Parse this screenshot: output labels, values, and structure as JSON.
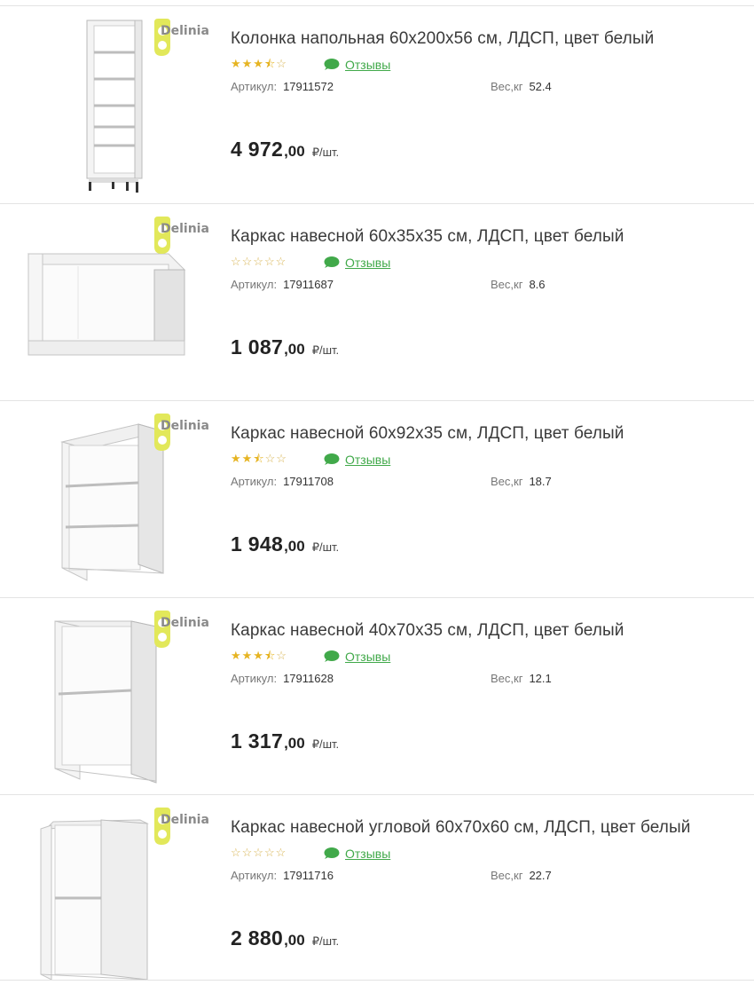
{
  "brand": {
    "logo_text": "Delinia",
    "color": "#e2e85a",
    "text_color": "#8a8a8a"
  },
  "labels": {
    "sku": "Артикул:",
    "weight": "Вес,кг",
    "reviews": "Отзывы",
    "unit": "₽/шт."
  },
  "colors": {
    "star": "#e6b422",
    "link": "#41a94a",
    "separator": "#e3e3e3"
  },
  "products": [
    {
      "title": "Колонка напольная 60x200x56 см, ЛДСП, цвет белый",
      "rating": 3.5,
      "rating_stars": "★★★⯪☆",
      "sku": "17911572",
      "weight": "52.4",
      "price_int": "4 972",
      "price_dec": ",00",
      "image": "tall-column-cabinet"
    },
    {
      "title": "Каркас навесной 60x35x35 см, ЛДСП, цвет белый",
      "rating": 0,
      "rating_stars": "☆☆☆☆☆",
      "sku": "17911687",
      "weight": "8.6",
      "price_int": "1 087",
      "price_dec": ",00",
      "image": "low-wall-cabinet"
    },
    {
      "title": "Каркас навесной 60x92x35 см, ЛДСП, цвет белый",
      "rating": 2.5,
      "rating_stars": "★★⯪☆☆",
      "sku": "17911708",
      "weight": "18.7",
      "price_int": "1 948",
      "price_dec": ",00",
      "image": "wall-cabinet-two-shelves"
    },
    {
      "title": "Каркас навесной 40x70x35 см, ЛДСП, цвет белый",
      "rating": 3.5,
      "rating_stars": "★★★⯪☆",
      "sku": "17911628",
      "weight": "12.1",
      "price_int": "1 317",
      "price_dec": ",00",
      "image": "narrow-wall-cabinet"
    },
    {
      "title": "Каркас навесной угловой 60x70x60 см, ЛДСП, цвет белый",
      "rating": 0,
      "rating_stars": "☆☆☆☆☆",
      "sku": "17911716",
      "weight": "22.7",
      "price_int": "2 880",
      "price_dec": ",00",
      "image": "corner-wall-cabinet"
    }
  ]
}
